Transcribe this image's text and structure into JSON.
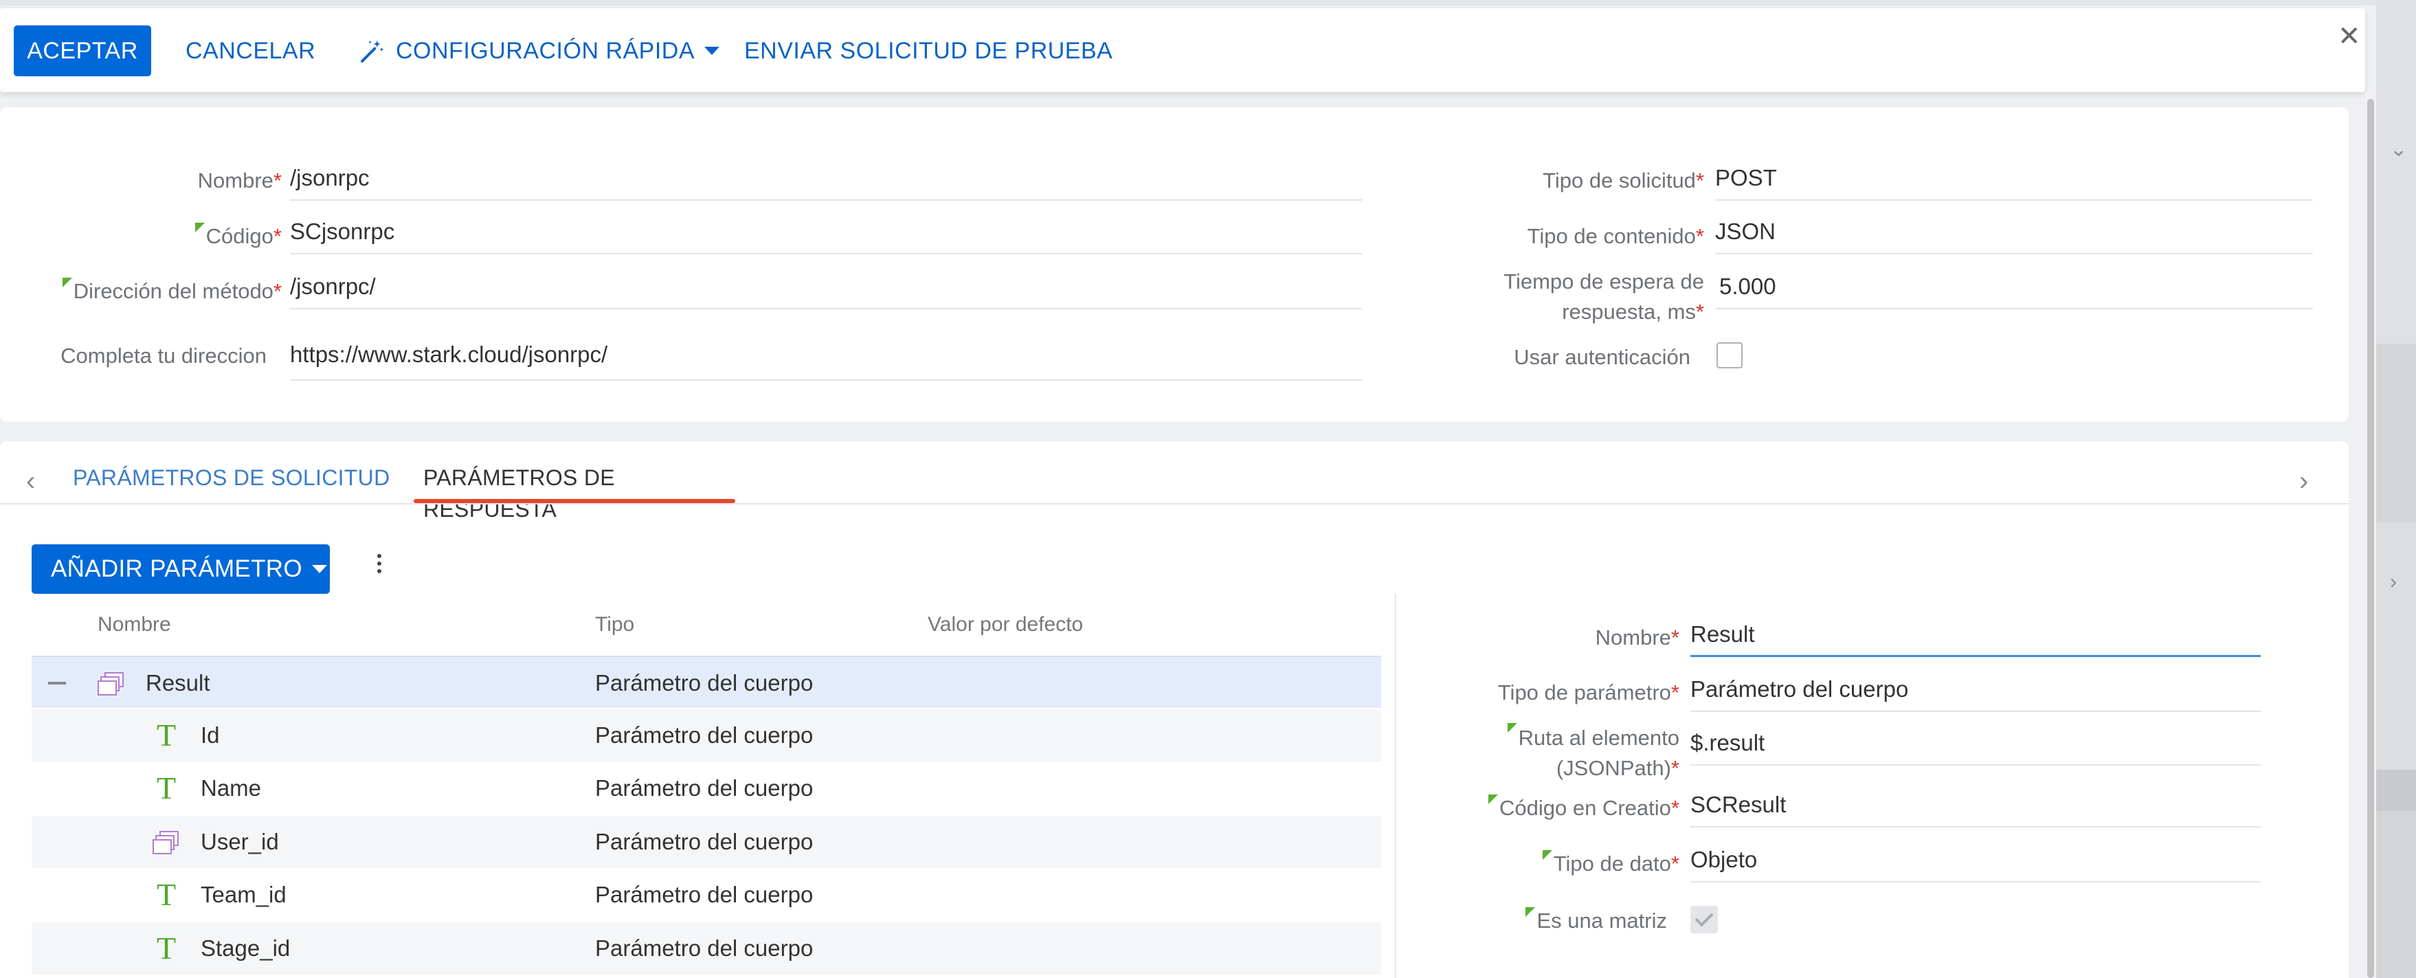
{
  "toolbar": {
    "accept_label": "ACEPTAR",
    "cancel_label": "CANCELAR",
    "quick_setup_label": "CONFIGURACIÓN RÁPIDA",
    "test_request_label": "ENVIAR SOLICITUD DE PRUEBA"
  },
  "form": {
    "name_label": "Nombre",
    "name_value": "/jsonrpc",
    "code_label": "Código",
    "code_value": "SCjsonrpc",
    "method_label": "Dirección del método",
    "method_value": "/jsonrpc/",
    "full_address_label": "Completa tu direccion",
    "full_address_value": "https://www.stark.cloud/jsonrpc/",
    "request_type_label": "Tipo de solicitud",
    "request_type_value": "POST",
    "content_type_label": "Tipo de contenido",
    "content_type_value": "JSON",
    "timeout_label_1": "Tiempo de espera de",
    "timeout_label_2": "respuesta, ms",
    "timeout_value": "5.000",
    "use_auth_label": "Usar autenticación"
  },
  "tabs": {
    "request_params": "PARÁMETROS DE SOLICITUD",
    "response_params": "PARÁMETROS DE RESPUESTA"
  },
  "params": {
    "add_label": "AÑADIR PARÁMETRO",
    "columns": {
      "name": "Nombre",
      "type": "Tipo",
      "default": "Valor por defecto"
    },
    "rows": [
      {
        "name": "Result",
        "type": "Parámetro del cuerpo"
      },
      {
        "name": "Id",
        "type": "Parámetro del cuerpo"
      },
      {
        "name": "Name",
        "type": "Parámetro del cuerpo"
      },
      {
        "name": "User_id",
        "type": "Parámetro del cuerpo"
      },
      {
        "name": "Team_id",
        "type": "Parámetro del cuerpo"
      },
      {
        "name": "Stage_id",
        "type": "Parámetro del cuerpo"
      }
    ]
  },
  "detail": {
    "name_label": "Nombre",
    "name_value": "Result",
    "param_type_label": "Tipo de parámetro",
    "param_type_value": "Parámetro del cuerpo",
    "path_label_1": "Ruta al elemento",
    "path_label_2": "(JSONPath)",
    "path_value": "$.result",
    "creatio_code_label": "Código en Creatio",
    "creatio_code_value": "SCResult",
    "data_type_label": "Tipo de dato",
    "data_type_value": "Objeto",
    "is_array_label": "Es una matriz"
  },
  "colors": {
    "primary": "#0068d8",
    "link": "#0b63c4",
    "required": "#e0342c",
    "tab_active_underline": "#e8452c",
    "text_icon": "#4ea82a",
    "object_icon": "#b37bd0"
  }
}
